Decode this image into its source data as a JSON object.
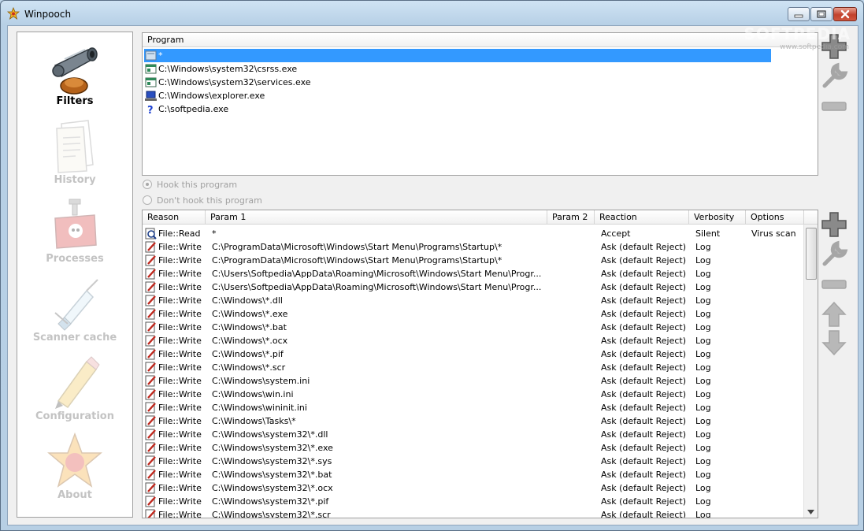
{
  "window": {
    "title": "Winpooch"
  },
  "watermark": {
    "brand": "SOFTPEDIA",
    "url": "www.softpedia.com"
  },
  "nav": [
    {
      "label": "Filters",
      "icon": "cannon-icon",
      "active": true
    },
    {
      "label": "History",
      "icon": "papers-icon",
      "active": false
    },
    {
      "label": "Processes",
      "icon": "bomb-icon",
      "active": false
    },
    {
      "label": "Scanner cache",
      "icon": "syringe-icon",
      "active": false
    },
    {
      "label": "Configuration",
      "icon": "pencil-icon",
      "active": false
    },
    {
      "label": "About",
      "icon": "star-icon",
      "active": false
    }
  ],
  "programs": {
    "header": "Program",
    "rows": [
      {
        "name": "*",
        "icon": "wildcard-icon",
        "selected": true
      },
      {
        "name": "C:\\Windows\\system32\\csrss.exe",
        "icon": "window-icon"
      },
      {
        "name": "C:\\Windows\\system32\\services.exe",
        "icon": "window-icon"
      },
      {
        "name": "C:\\Windows\\explorer.exe",
        "icon": "computer-icon"
      },
      {
        "name": "C:\\softpedia.exe",
        "icon": "question-icon"
      }
    ]
  },
  "hook": {
    "hook_label": "Hook this program",
    "nohook_label": "Don't hook this program"
  },
  "rules": {
    "headers": [
      "Reason",
      "Param 1",
      "Param 2",
      "Reaction",
      "Verbosity",
      "Options"
    ],
    "rows": [
      [
        "File::Read",
        "*",
        "",
        "Accept",
        "Silent",
        "Virus scan"
      ],
      [
        "File::Write",
        "C:\\ProgramData\\Microsoft\\Windows\\Start Menu\\Programs\\Startup\\*",
        "",
        "Ask (default Reject)",
        "Log",
        ""
      ],
      [
        "File::Write",
        "C:\\ProgramData\\Microsoft\\Windows\\Start Menu\\Programs\\Startup\\*",
        "",
        "Ask (default Reject)",
        "Log",
        ""
      ],
      [
        "File::Write",
        "C:\\Users\\Softpedia\\AppData\\Roaming\\Microsoft\\Windows\\Start Menu\\Progr...",
        "",
        "Ask (default Reject)",
        "Log",
        ""
      ],
      [
        "File::Write",
        "C:\\Users\\Softpedia\\AppData\\Roaming\\Microsoft\\Windows\\Start Menu\\Progr...",
        "",
        "Ask (default Reject)",
        "Log",
        ""
      ],
      [
        "File::Write",
        "C:\\Windows\\*.dll",
        "",
        "Ask (default Reject)",
        "Log",
        ""
      ],
      [
        "File::Write",
        "C:\\Windows\\*.exe",
        "",
        "Ask (default Reject)",
        "Log",
        ""
      ],
      [
        "File::Write",
        "C:\\Windows\\*.bat",
        "",
        "Ask (default Reject)",
        "Log",
        ""
      ],
      [
        "File::Write",
        "C:\\Windows\\*.ocx",
        "",
        "Ask (default Reject)",
        "Log",
        ""
      ],
      [
        "File::Write",
        "C:\\Windows\\*.pif",
        "",
        "Ask (default Reject)",
        "Log",
        ""
      ],
      [
        "File::Write",
        "C:\\Windows\\*.scr",
        "",
        "Ask (default Reject)",
        "Log",
        ""
      ],
      [
        "File::Write",
        "C:\\Windows\\system.ini",
        "",
        "Ask (default Reject)",
        "Log",
        ""
      ],
      [
        "File::Write",
        "C:\\Windows\\win.ini",
        "",
        "Ask (default Reject)",
        "Log",
        ""
      ],
      [
        "File::Write",
        "C:\\Windows\\wininit.ini",
        "",
        "Ask (default Reject)",
        "Log",
        ""
      ],
      [
        "File::Write",
        "C:\\Windows\\Tasks\\*",
        "",
        "Ask (default Reject)",
        "Log",
        ""
      ],
      [
        "File::Write",
        "C:\\Windows\\system32\\*.dll",
        "",
        "Ask (default Reject)",
        "Log",
        ""
      ],
      [
        "File::Write",
        "C:\\Windows\\system32\\*.exe",
        "",
        "Ask (default Reject)",
        "Log",
        ""
      ],
      [
        "File::Write",
        "C:\\Windows\\system32\\*.sys",
        "",
        "Ask (default Reject)",
        "Log",
        ""
      ],
      [
        "File::Write",
        "C:\\Windows\\system32\\*.bat",
        "",
        "Ask (default Reject)",
        "Log",
        ""
      ],
      [
        "File::Write",
        "C:\\Windows\\system32\\*.ocx",
        "",
        "Ask (default Reject)",
        "Log",
        ""
      ],
      [
        "File::Write",
        "C:\\Windows\\system32\\*.pif",
        "",
        "Ask (default Reject)",
        "Log",
        ""
      ],
      [
        "File::Write",
        "C:\\Windows\\system32\\*.scr",
        "",
        "Ask (default Reject)",
        "Log",
        ""
      ]
    ]
  },
  "colors": {
    "selection": "#3399ff",
    "disabled_text": "#c3c3c3",
    "tool_gray": "#8a8a8a"
  }
}
